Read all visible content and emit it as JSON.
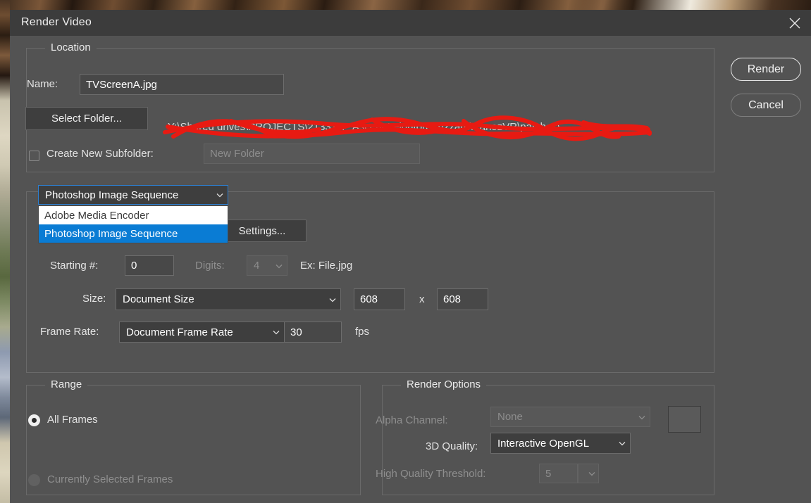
{
  "window": {
    "title": "Render Video",
    "close_icon": "close-icon"
  },
  "actions": {
    "render_label": "Render",
    "cancel_label": "Cancel"
  },
  "location": {
    "group_title": "Location",
    "name_label": "Name:",
    "name_value": "TVScreenA.jpg",
    "select_folder_label": "Select Folder...",
    "folder_path": "Y:\\Shared drives\\PROJECTS\\21331A - Ascent Leighton Buzzard\\PanozVR\\patches\\",
    "create_subfolder_label": "Create New Subfolder:",
    "create_subfolder_checked": false,
    "subfolder_placeholder": "New Folder"
  },
  "format": {
    "combo_value": "Photoshop Image Sequence",
    "dropdown_open": true,
    "dropdown_options": [
      {
        "label": "Adobe Media Encoder",
        "selected": false
      },
      {
        "label": "Photoshop Image Sequence",
        "selected": true
      }
    ],
    "settings_label": "Settings...",
    "starting_number_label": "Starting #:",
    "starting_number_value": "0",
    "digits_label": "Digits:",
    "digits_value": "4",
    "digits_disabled": true,
    "example_label": "Ex: File.jpg",
    "size_label": "Size:",
    "size_combo_value": "Document Size",
    "size_width": "608",
    "size_separator": "x",
    "size_height": "608",
    "frame_rate_label": "Frame Rate:",
    "frame_rate_combo_value": "Document Frame Rate",
    "frame_rate_value": "30",
    "fps_label": "fps"
  },
  "range": {
    "group_title": "Range",
    "all_frames_label": "All Frames",
    "all_frames_selected": true,
    "selected_frames_label": "Currently Selected Frames",
    "selected_frames_disabled": true
  },
  "render_options": {
    "group_title": "Render Options",
    "alpha_channel_label": "Alpha Channel:",
    "alpha_channel_value": "None",
    "alpha_channel_disabled": true,
    "quality_3d_label": "3D Quality:",
    "quality_3d_value": "Interactive OpenGL",
    "high_quality_threshold_label": "High Quality Threshold:",
    "high_quality_threshold_value": "5",
    "high_quality_threshold_disabled": true
  },
  "colors": {
    "dialog_bg": "#535353",
    "titlebar_bg": "#3c3c3c",
    "field_bg": "#484848",
    "highlight_blue": "#0a7cd4",
    "focus_border": "#2c7fd1",
    "redaction_red": "#e81a12"
  }
}
